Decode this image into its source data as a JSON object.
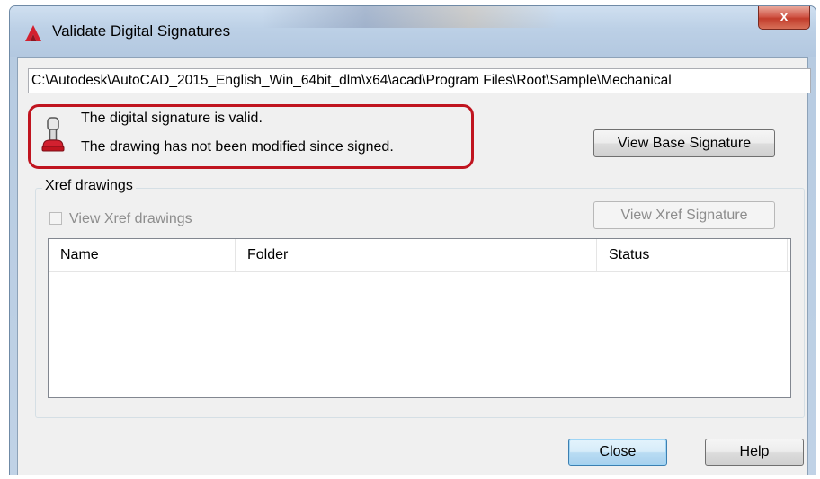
{
  "window": {
    "title": "Validate Digital Signatures",
    "close_glyph": "x",
    "app_icon": "autocad-icon",
    "colors": {
      "titlebar": "#b9cde4",
      "close_button": "#c94a3a",
      "highlight_border": "#c0141f",
      "default_button": "#3c7fb1"
    }
  },
  "path_field": {
    "value": "C:\\Autodesk\\AutoCAD_2015_English_Win_64bit_dlm\\x64\\acad\\Program Files\\Root\\Sample\\Mechanical"
  },
  "signature": {
    "icon": "stamp-icon",
    "line1": "The digital signature is valid.",
    "line2": "The drawing has not been modified since signed.",
    "view_base_label": "View Base Signature"
  },
  "xref": {
    "group_label": "Xref drawings",
    "checkbox_label": "View Xref drawings",
    "checkbox_checked": false,
    "view_xref_label": "View Xref Signature",
    "columns": [
      "Name",
      "Folder",
      "Status"
    ],
    "rows": []
  },
  "footer": {
    "close_label": "Close",
    "help_label": "Help"
  }
}
